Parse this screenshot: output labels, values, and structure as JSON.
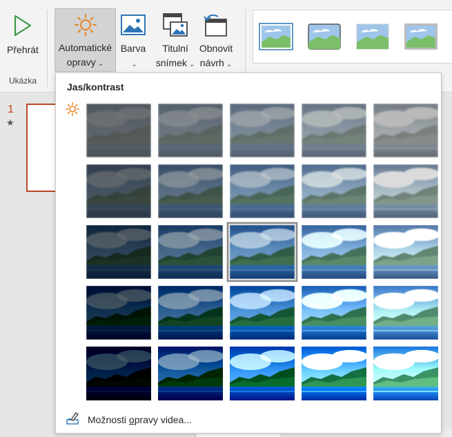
{
  "ribbon": {
    "buttons": {
      "play": {
        "label": "Přehrát",
        "icon": "play-icon"
      },
      "auto_corrections": {
        "label_line1": "Automatické",
        "label_line2": "opravy",
        "icon": "sun-icon"
      },
      "color": {
        "label_line1": "Barva",
        "icon": "picture-icon"
      },
      "poster_frame": {
        "label_line1": "Titulní",
        "label_line2": "snímek",
        "icon": "poster-frame-icon"
      },
      "reset_design": {
        "label_line1": "Obnovit",
        "label_line2": "návrh",
        "icon": "reset-design-icon"
      }
    },
    "group_label": "Ukázka",
    "chevron": "⌄"
  },
  "slides": {
    "number": "1",
    "star": "★"
  },
  "dropdown": {
    "title": "Jas/kontrast",
    "footer_prefix": "Možnosti ",
    "footer_underlined": "o",
    "footer_suffix": "pravy videa...",
    "grid_rows": 5,
    "grid_cols": 5,
    "selected": {
      "row": 3,
      "col": 3
    },
    "brightness_levels": [
      "-40%",
      "-20%",
      "0%",
      "+20%",
      "+40%"
    ],
    "contrast_levels": [
      "-40%",
      "-20%",
      "0%",
      "+20%",
      "+40%"
    ]
  },
  "colors": {
    "accent": "#c43e1c",
    "panel_border": "#c6c6c6",
    "sun_orange": "#e8821e",
    "play_green": "#3a9a45"
  }
}
